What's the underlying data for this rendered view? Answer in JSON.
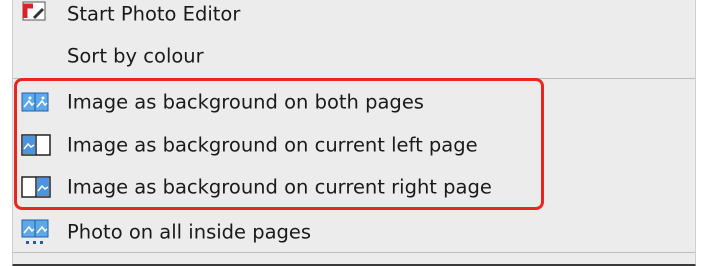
{
  "menu": {
    "items": [
      {
        "label": "Start Photo Editor",
        "icon": "photo-editor-icon"
      },
      {
        "label": "Sort by colour",
        "icon": ""
      },
      {
        "label": "Image as background on both pages",
        "icon": "both-pages-icon"
      },
      {
        "label": "Image as background on current left page",
        "icon": "left-page-icon"
      },
      {
        "label": "Image as background on current right page",
        "icon": "right-page-icon"
      },
      {
        "label": "Photo on all  inside pages",
        "icon": "all-pages-icon"
      }
    ]
  },
  "colors": {
    "highlight": "#e8281e",
    "menu_bg": "#ececec",
    "icon_blue": "#2f7fd1"
  }
}
